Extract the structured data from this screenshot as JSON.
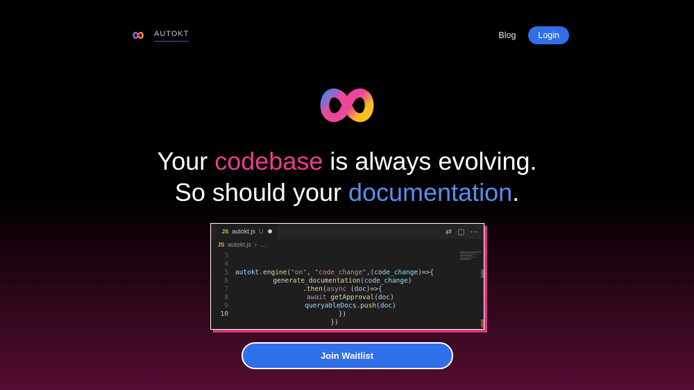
{
  "brand": {
    "name": "AUTOKT"
  },
  "nav": {
    "blog": "Blog",
    "login": "Login"
  },
  "headline": {
    "l1a": "Your ",
    "l1b": "codebase",
    "l1c": " is always evolving.",
    "l2a": "So should your ",
    "l2b": "documentation",
    "l2c": "."
  },
  "editor": {
    "filename": "autokt.js",
    "unsaved": "U",
    "breadcrumb_more": "…",
    "line_numbers": [
      "3",
      "4",
      "5",
      "6",
      "7",
      "8",
      "9",
      "10"
    ],
    "code": {
      "l4": {
        "obj": "autokt",
        "fn": "engine",
        "s1": "\"on\"",
        "s2": "\"code_change\"",
        "param": "code_change"
      },
      "l5": {
        "fn": "generate_documentation",
        "param": "code_change"
      },
      "l6": {
        "fn": "then",
        "kw": "async",
        "param": "doc"
      },
      "l7": {
        "kw": "await",
        "fn": "getApproval",
        "param": "doc"
      },
      "l8": {
        "obj": "queryableDocs",
        "fn": "push",
        "param": "doc"
      }
    }
  },
  "cta": {
    "label": "Join Waitlist"
  }
}
